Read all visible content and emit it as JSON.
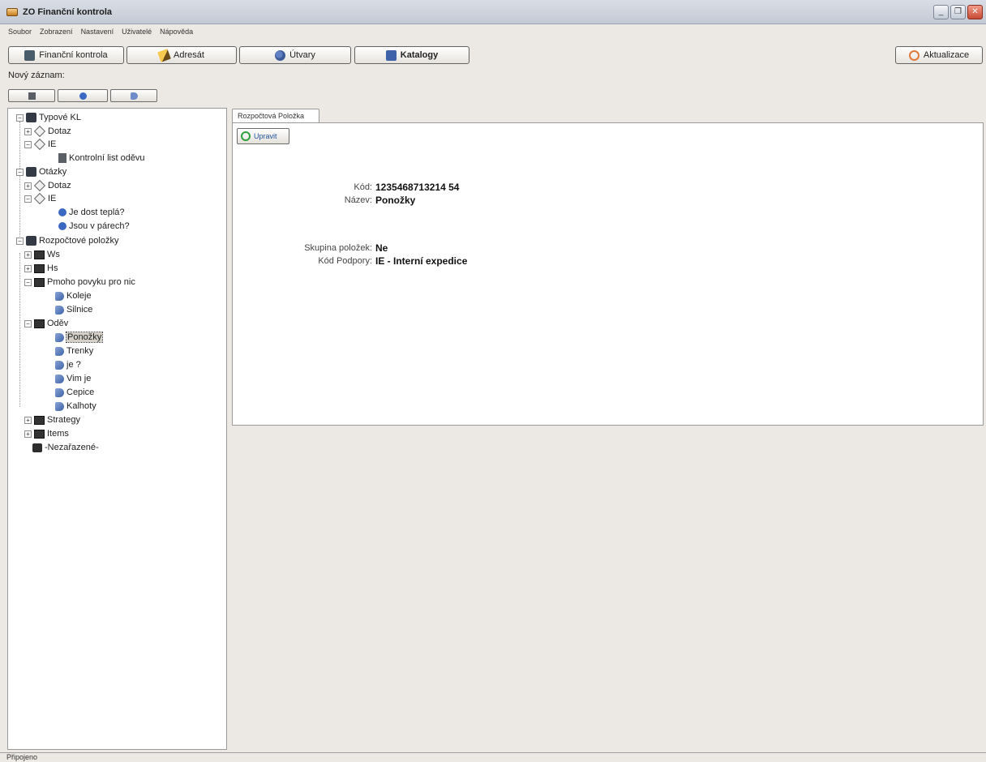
{
  "window": {
    "title": "ZO Finanční kontrola",
    "minimize": "_",
    "restore": "❐",
    "close": "✕"
  },
  "menu": [
    "Soubor",
    "Zobrazení",
    "Nastavení",
    "Uživatelé",
    "Nápověda"
  ],
  "toolbar": {
    "financni_kontrola": "Finanční kontrola",
    "adresat": "Adresát",
    "utvary": "Útvary",
    "katalogy": "Katalogy",
    "aktualizace": "Aktualizace"
  },
  "new_record_label": "Nový záznam:",
  "tree": {
    "typove_kl": "Typové KL",
    "typove_dotaz": "Dotaz",
    "typove_ie": "IE",
    "kontrolni_list": "Kontrolní list oděvu",
    "otazky": "Otázky",
    "otazky_dotaz": "Dotaz",
    "otazky_ie": "IE",
    "je_dost_tepla": "Je dost teplá?",
    "jsou_v_parech": "Jsou v párech?",
    "rozpoctove_polozky": "Rozpočtové položky",
    "ws": "Ws",
    "hs": "Hs",
    "pmoho": "Pmoho povyku pro nic",
    "koleje": "Koleje",
    "silnice": "Silnice",
    "odev": "Oděv",
    "ponozky": "Ponožky",
    "trenky": "Trenky",
    "je": "je ?",
    "vim_je": "Vim je",
    "cepice": "Cepice",
    "kalhoty": "Kalhoty",
    "strategy": "Strategy",
    "items": "Items",
    "nezarazene": "-Nezařazené-"
  },
  "detail": {
    "tab_label": "Rozpočtová Položka",
    "edit_button": "Upravit",
    "kod_label": "Kód:",
    "kod_value": "1235468713214 54",
    "nazev_label": "Název:",
    "nazev_value": "Ponožky",
    "skupina_label": "Skupina položek:",
    "skupina_value": "Ne",
    "kod_podpory_label": "Kód Podpory:",
    "kod_podpory_value": "IE - Interní expedice"
  },
  "status": "Připojeno"
}
